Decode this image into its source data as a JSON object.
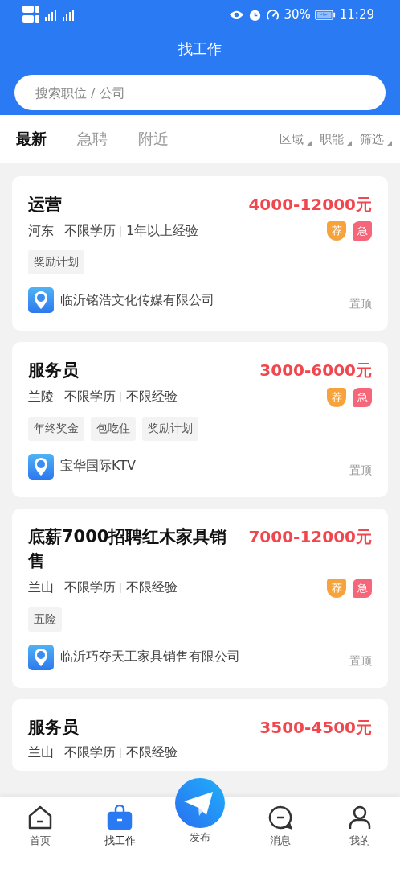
{
  "status_bar": {
    "battery": "30%",
    "time": "11:29"
  },
  "header": {
    "title": "找工作"
  },
  "search": {
    "placeholder": "搜索职位 / 公司"
  },
  "tabs": [
    {
      "label": "最新",
      "selected": true
    },
    {
      "label": "急聘",
      "selected": false
    },
    {
      "label": "附近",
      "selected": false
    }
  ],
  "filters": [
    "区域",
    "职能",
    "筛选"
  ],
  "jobs": [
    {
      "title": "运营",
      "salary": "4000-12000元",
      "meta": [
        "河东",
        "不限学历",
        "1年以上经验"
      ],
      "badges": [
        {
          "kind": "recommend",
          "label": "荐"
        },
        {
          "kind": "urgent",
          "label": "急"
        }
      ],
      "tags": [
        "奖励计划"
      ],
      "company": "临沂铭浩文化传媒有限公司",
      "pin": "置顶"
    },
    {
      "title": "服务员",
      "salary": "3000-6000元",
      "meta": [
        "兰陵",
        "不限学历",
        "不限经验"
      ],
      "badges": [
        {
          "kind": "recommend",
          "label": "荐"
        },
        {
          "kind": "urgent",
          "label": "急"
        }
      ],
      "tags": [
        "年终奖金",
        "包吃住",
        "奖励计划"
      ],
      "company": "宝华国际KTV",
      "pin": "置顶"
    },
    {
      "title": "底薪7000招聘红木家具销售",
      "salary": "7000-12000元",
      "meta": [
        "兰山",
        "不限学历",
        "不限经验"
      ],
      "badges": [
        {
          "kind": "recommend",
          "label": "荐"
        },
        {
          "kind": "urgent",
          "label": "急"
        }
      ],
      "tags": [
        "五险"
      ],
      "company": "临沂巧夺天工家具销售有限公司",
      "pin": "置顶"
    },
    {
      "title": "服务员",
      "salary": "3500-4500元",
      "meta": [
        "兰山",
        "不限学历",
        "不限经验"
      ]
    }
  ],
  "nav": [
    {
      "kind": "home",
      "label": "首页",
      "selected": false
    },
    {
      "kind": "jobs",
      "label": "找工作",
      "selected": true
    },
    {
      "kind": "publish",
      "label": "发布",
      "selected": false
    },
    {
      "kind": "messages",
      "label": "消息",
      "selected": false
    },
    {
      "kind": "profile",
      "label": "我的",
      "selected": false
    }
  ]
}
